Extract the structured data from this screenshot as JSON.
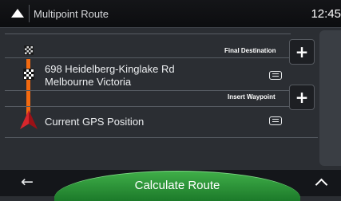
{
  "header": {
    "title": "Multipoint Route",
    "clock": "12:45"
  },
  "destination": {
    "label": "Final Destination",
    "address_line1": "698 Heidelberg-Kinglake Rd",
    "address_line2": "Melbourne Victoria",
    "add_symbol": "+"
  },
  "waypoint": {
    "label": "Insert Waypoint",
    "add_symbol": "+"
  },
  "origin": {
    "label": "Current GPS Position"
  },
  "footer": {
    "back_symbol": "←",
    "calculate_label": "Calculate Route"
  },
  "colors": {
    "route_line": "#f36a10",
    "calculate_button": "#2e9a3a",
    "gps_marker": "#d8262c"
  },
  "icons": [
    "back-icon",
    "start-flag-icon",
    "destination-flag-icon",
    "gps-position-icon",
    "add-icon",
    "details-icon",
    "back-arrow-icon",
    "chevron-up-icon"
  ]
}
